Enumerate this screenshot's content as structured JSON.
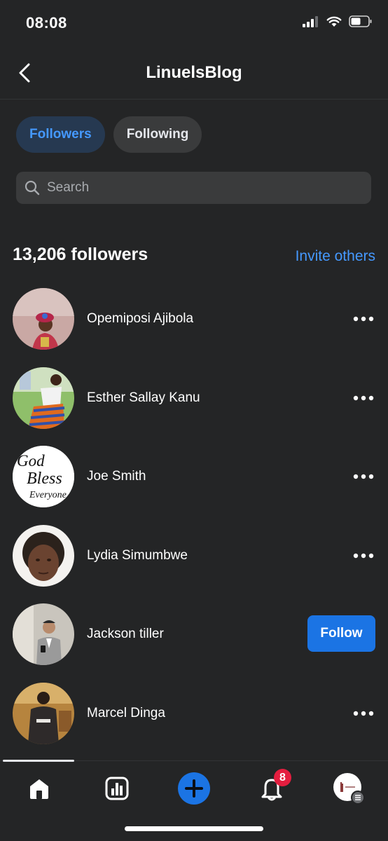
{
  "status_bar": {
    "time": "08:08"
  },
  "header": {
    "title": "LinuelsBlog"
  },
  "tabs": [
    {
      "label": "Followers",
      "active": true
    },
    {
      "label": "Following",
      "active": false
    }
  ],
  "search": {
    "placeholder": "Search",
    "value": ""
  },
  "followers": {
    "count_label": "13,206 followers",
    "invite_label": "Invite others"
  },
  "list": [
    {
      "name": "Opemiposi Ajibola",
      "action": "more"
    },
    {
      "name": "Esther Sallay Kanu",
      "action": "more"
    },
    {
      "name": "Joe Smith",
      "action": "more",
      "avatar_text": [
        "God",
        "Bless",
        "Everyone"
      ]
    },
    {
      "name": "Lydia Simumbwe",
      "action": "more"
    },
    {
      "name": "Jackson tiller",
      "action": "follow",
      "follow_label": "Follow"
    },
    {
      "name": "Marcel Dinga",
      "action": "more"
    }
  ],
  "tabbar": {
    "items": [
      "home-icon",
      "dashboard-icon",
      "create-icon",
      "notifications-icon",
      "profile-icon"
    ],
    "notifications_badge": "8"
  },
  "colors": {
    "background": "#242526",
    "accent": "#4599ff",
    "follow_button": "#1b74e4",
    "badge": "#e41e3f"
  }
}
